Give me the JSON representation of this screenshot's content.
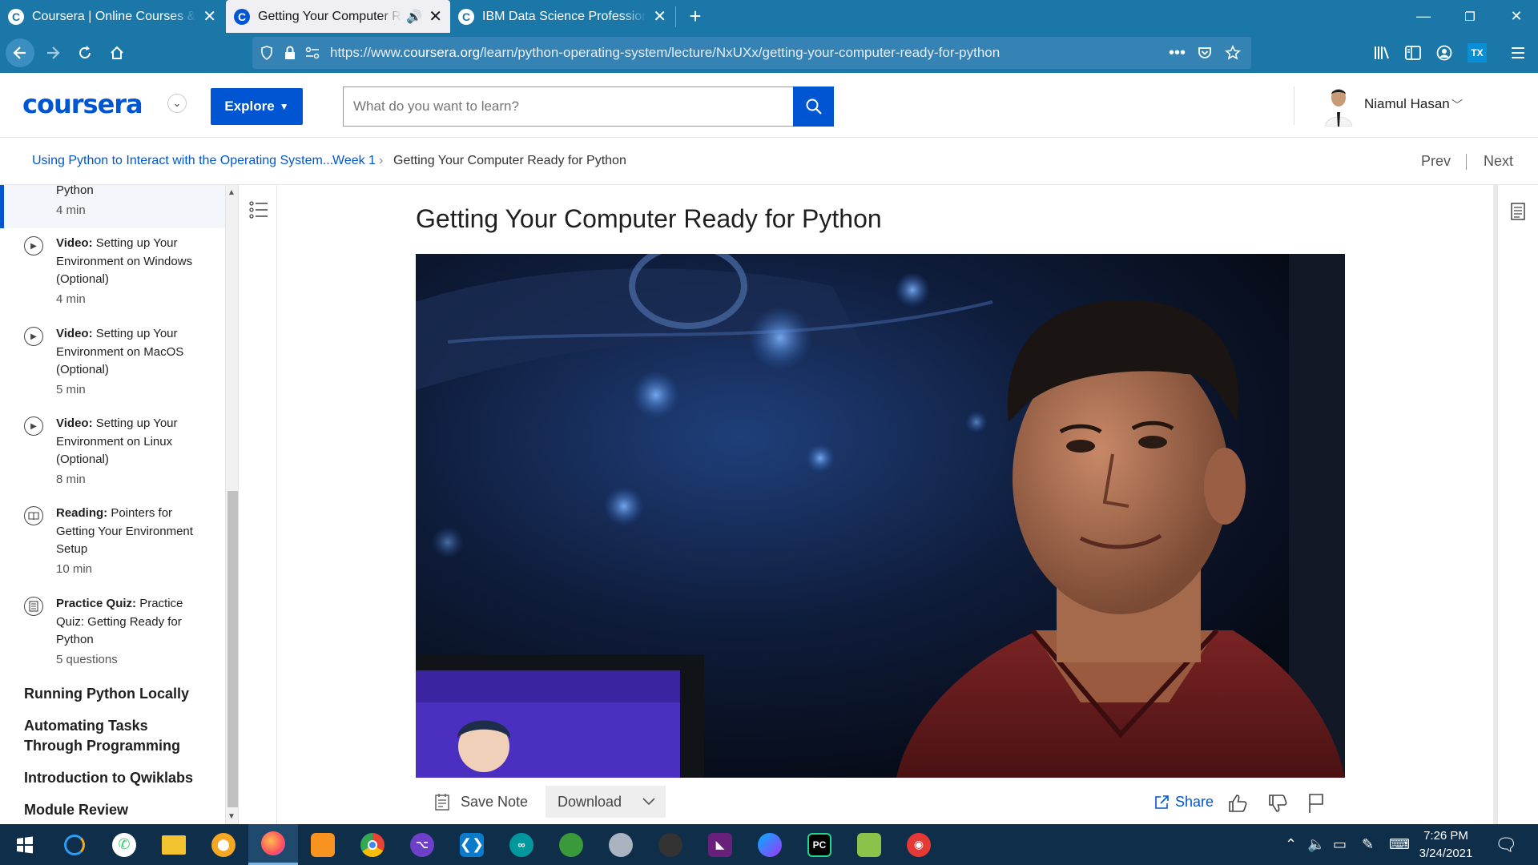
{
  "browser": {
    "tabs": [
      {
        "title": "Coursera | Online Courses & Credentials",
        "favicon": "C",
        "active": false
      },
      {
        "title": "Getting Your Computer Ready for Python",
        "favicon": "C",
        "active": true,
        "audio": true
      },
      {
        "title": "IBM Data Science Professional Certificate",
        "favicon": "C",
        "active": false
      }
    ],
    "new_tab": "+",
    "url": {
      "prefix": "https://www.",
      "domain": "coursera.org",
      "path": "/learn/python-operating-system/lecture/NxUXx/getting-your-computer-ready-for-python"
    }
  },
  "header": {
    "logo": "coursera",
    "explore_label": "Explore",
    "search_placeholder": "What do you want to learn?",
    "user_name": "Niamul Hasan"
  },
  "breadcrumb": {
    "course": "Using Python to Interact with the Operating System...",
    "week": "Week 1",
    "current": "Getting Your Computer Ready for Python",
    "prev": "Prev",
    "next": "Next"
  },
  "sidebar": {
    "items": [
      {
        "type": "",
        "title": "Python",
        "duration": "4 min",
        "icon": "none"
      },
      {
        "type": "Video:",
        "title": "Setting up Your Environment on Windows (Optional)",
        "duration": "4 min",
        "icon": "play-icon"
      },
      {
        "type": "Video:",
        "title": "Setting up Your Environment on MacOS (Optional)",
        "duration": "5 min",
        "icon": "play-icon"
      },
      {
        "type": "Video:",
        "title": "Setting up Your Environment on Linux (Optional)",
        "duration": "8 min",
        "icon": "play-icon"
      },
      {
        "type": "Reading:",
        "title": "Pointers for Getting Your Environment Setup",
        "duration": "10 min",
        "icon": "book-icon"
      },
      {
        "type": "Practice Quiz:",
        "title": "Practice Quiz: Getting Ready for Python",
        "duration": "5 questions",
        "icon": "quiz-icon"
      }
    ],
    "sections": [
      "Running Python Locally",
      "Automating Tasks Through Programming",
      "Introduction to Qwiklabs",
      "Module Review"
    ]
  },
  "main": {
    "title": "Getting Your Computer Ready for Python",
    "save_note": "Save Note",
    "download": "Download",
    "share": "Share"
  },
  "taskbar": {
    "time": "7:26 PM",
    "date": "3/24/2021"
  },
  "colors": {
    "brand_blue": "#0056d2",
    "browser_chrome": "#1b77a8",
    "taskbar": "#0f2e4a"
  }
}
